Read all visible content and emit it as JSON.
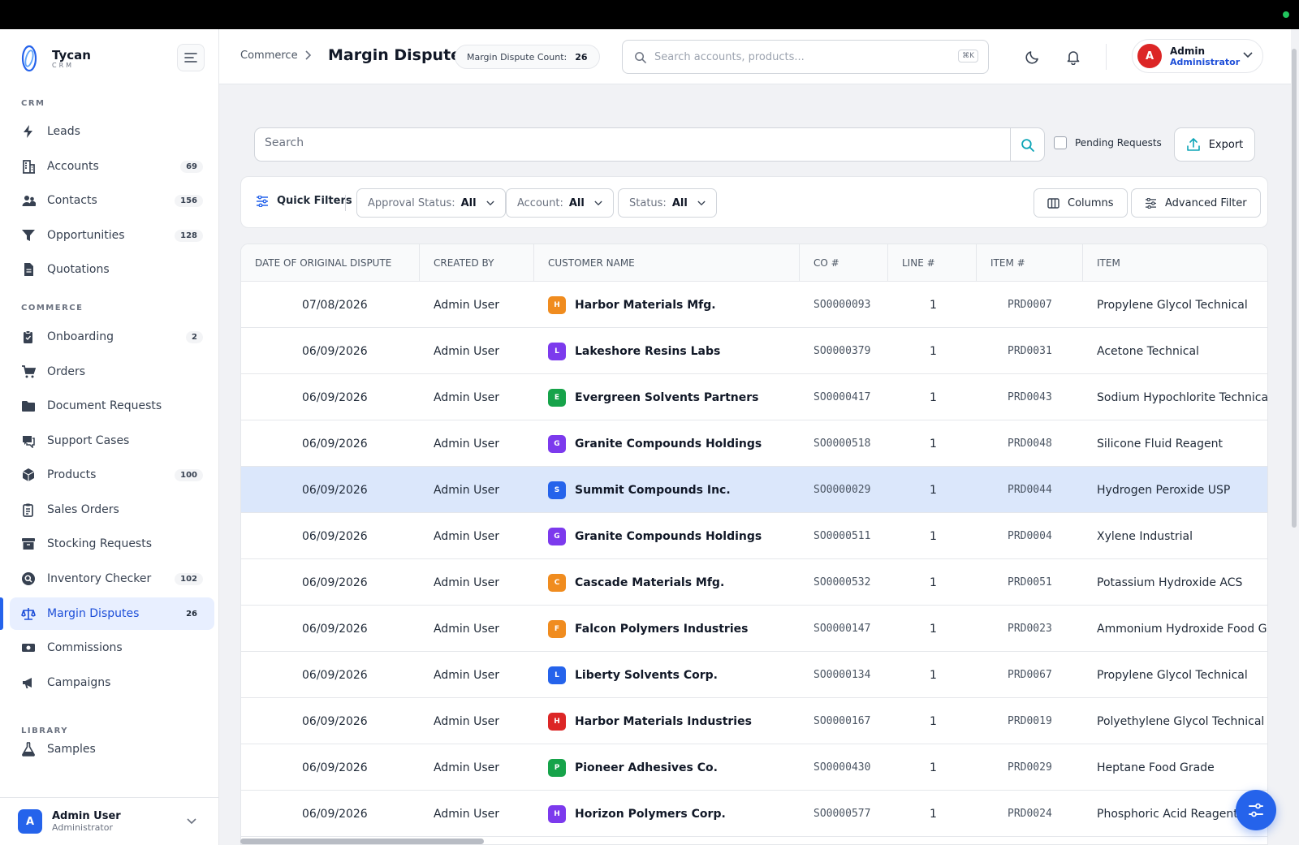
{
  "brand": {
    "name": "Tycan",
    "sub": "CRM"
  },
  "sidebar": {
    "sections": [
      "CRM",
      "COMMERCE",
      "LIBRARY"
    ],
    "items": [
      {
        "label": "Leads",
        "badge": "",
        "icon": "bolt-icon"
      },
      {
        "label": "Accounts",
        "badge": "69",
        "icon": "building-icon"
      },
      {
        "label": "Contacts",
        "badge": "156",
        "icon": "users-icon"
      },
      {
        "label": "Opportunities",
        "badge": "128",
        "icon": "funnel-icon"
      },
      {
        "label": "Quotations",
        "badge": "",
        "icon": "document-icon"
      },
      {
        "label": "Onboarding",
        "badge": "2",
        "icon": "clipboard-icon"
      },
      {
        "label": "Orders",
        "badge": "",
        "icon": "cart-icon"
      },
      {
        "label": "Document Requests",
        "badge": "",
        "icon": "folder-icon"
      },
      {
        "label": "Support Cases",
        "badge": "",
        "icon": "chat-icon"
      },
      {
        "label": "Products",
        "badge": "100",
        "icon": "box-icon"
      },
      {
        "label": "Sales Orders",
        "badge": "",
        "icon": "clipboard-list-icon"
      },
      {
        "label": "Stocking Requests",
        "badge": "",
        "icon": "archive-icon"
      },
      {
        "label": "Inventory Checker",
        "badge": "102",
        "icon": "search-circle-icon"
      },
      {
        "label": "Margin Disputes",
        "badge": "26",
        "icon": "scale-icon",
        "active": true
      },
      {
        "label": "Commissions",
        "badge": "",
        "icon": "cash-icon"
      },
      {
        "label": "Campaigns",
        "badge": "",
        "icon": "megaphone-icon"
      },
      {
        "label": "Samples",
        "badge": "",
        "icon": "flask-icon"
      }
    ],
    "user": {
      "initial": "A",
      "name": "Admin User",
      "role": "Administrator"
    }
  },
  "header": {
    "breadcrumb": "Commerce",
    "title": "Margin Dispute",
    "count_label": "Margin Dispute Count:",
    "count_value": "26",
    "search_placeholder": "Search accounts, products...",
    "search_shortcut": "⌘K",
    "profile": {
      "initial": "A",
      "name": "Admin",
      "role": "Administrator"
    }
  },
  "toolbar": {
    "search_placeholder": "Search",
    "pending_label": "Pending Requests",
    "export_label": "Export"
  },
  "filters": {
    "quick_label": "Quick Filters",
    "approval": {
      "label": "Approval Status:",
      "value": "All"
    },
    "account": {
      "label": "Account:",
      "value": "All"
    },
    "status": {
      "label": "Status:",
      "value": "All"
    },
    "columns_label": "Columns",
    "advanced_label": "Advanced Filter"
  },
  "table": {
    "columns": [
      "DATE OF ORIGINAL DISPUTE",
      "CREATED BY",
      "CUSTOMER NAME",
      "CO #",
      "LINE #",
      "ITEM #",
      "ITEM"
    ],
    "rows": [
      {
        "date": "07/08/2026",
        "created_by": "Admin User",
        "initial": "H",
        "avatar_color": "#f08c1f",
        "customer": "Harbor Materials Mfg.",
        "co": "SO0000093",
        "line": "1",
        "item_no": "PRD0007",
        "item": "Propylene Glycol Technical"
      },
      {
        "date": "06/09/2026",
        "created_by": "Admin User",
        "initial": "L",
        "avatar_color": "#7c3aed",
        "customer": "Lakeshore Resins Labs",
        "co": "SO0000379",
        "line": "1",
        "item_no": "PRD0031",
        "item": "Acetone Technical"
      },
      {
        "date": "06/09/2026",
        "created_by": "Admin User",
        "initial": "E",
        "avatar_color": "#16a34a",
        "customer": "Evergreen Solvents Partners",
        "co": "SO0000417",
        "line": "1",
        "item_no": "PRD0043",
        "item": "Sodium Hypochlorite Technical"
      },
      {
        "date": "06/09/2026",
        "created_by": "Admin User",
        "initial": "G",
        "avatar_color": "#7c3aed",
        "customer": "Granite Compounds Holdings",
        "co": "SO0000518",
        "line": "1",
        "item_no": "PRD0048",
        "item": "Silicone Fluid Reagent"
      },
      {
        "date": "06/09/2026",
        "created_by": "Admin User",
        "initial": "S",
        "avatar_color": "#2563eb",
        "customer": "Summit Compounds Inc.",
        "co": "SO0000029",
        "line": "1",
        "item_no": "PRD0044",
        "item": "Hydrogen Peroxide USP",
        "selected": true
      },
      {
        "date": "06/09/2026",
        "created_by": "Admin User",
        "initial": "G",
        "avatar_color": "#7c3aed",
        "customer": "Granite Compounds Holdings",
        "co": "SO0000511",
        "line": "1",
        "item_no": "PRD0004",
        "item": "Xylene Industrial"
      },
      {
        "date": "06/09/2026",
        "created_by": "Admin User",
        "initial": "C",
        "avatar_color": "#f08c1f",
        "customer": "Cascade Materials Mfg.",
        "co": "SO0000532",
        "line": "1",
        "item_no": "PRD0051",
        "item": "Potassium Hydroxide ACS"
      },
      {
        "date": "06/09/2026",
        "created_by": "Admin User",
        "initial": "F",
        "avatar_color": "#f08c1f",
        "customer": "Falcon Polymers Industries",
        "co": "SO0000147",
        "line": "1",
        "item_no": "PRD0023",
        "item": "Ammonium Hydroxide Food Grad"
      },
      {
        "date": "06/09/2026",
        "created_by": "Admin User",
        "initial": "L",
        "avatar_color": "#2563eb",
        "customer": "Liberty Solvents Corp.",
        "co": "SO0000134",
        "line": "1",
        "item_no": "PRD0067",
        "item": "Propylene Glycol Technical"
      },
      {
        "date": "06/09/2026",
        "created_by": "Admin User",
        "initial": "H",
        "avatar_color": "#dc2626",
        "customer": "Harbor Materials Industries",
        "co": "SO0000167",
        "line": "1",
        "item_no": "PRD0019",
        "item": "Polyethylene Glycol Technical"
      },
      {
        "date": "06/09/2026",
        "created_by": "Admin User",
        "initial": "P",
        "avatar_color": "#16a34a",
        "customer": "Pioneer Adhesives Co.",
        "co": "SO0000430",
        "line": "1",
        "item_no": "PRD0029",
        "item": "Heptane Food Grade"
      },
      {
        "date": "06/09/2026",
        "created_by": "Admin User",
        "initial": "H",
        "avatar_color": "#7c3aed",
        "customer": "Horizon Polymers Corp.",
        "co": "SO0000577",
        "line": "1",
        "item_no": "PRD0024",
        "item": "Phosphoric Acid Reagent"
      }
    ]
  }
}
